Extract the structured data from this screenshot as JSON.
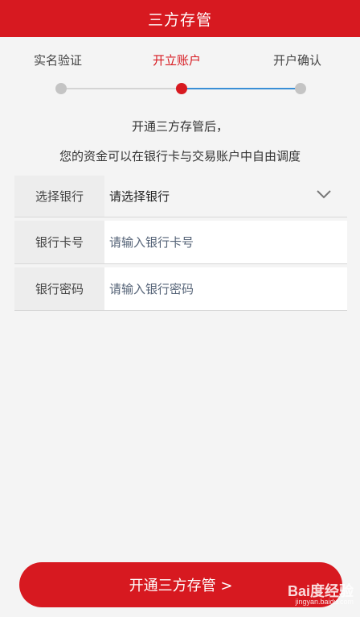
{
  "header": {
    "title": "三方存管"
  },
  "steps": [
    {
      "label": "实名验证",
      "state": "done"
    },
    {
      "label": "开立账户",
      "state": "active"
    },
    {
      "label": "开户确认",
      "state": "pending"
    }
  ],
  "info": {
    "line1": "开通三方存管后，",
    "line2": "您的资金可以在银行卡与交易账户中自由调度"
  },
  "form": {
    "bank_select": {
      "label": "选择银行",
      "value": "请选择银行",
      "icon": "chevron-down-icon"
    },
    "card_number": {
      "label": "银行卡号",
      "placeholder": "请输入银行卡号"
    },
    "bank_password": {
      "label": "银行密码",
      "placeholder": "请输入银行密码"
    }
  },
  "submit": {
    "label": "开通三方存管 >"
  },
  "watermark": {
    "logo": "Bai度经验",
    "url": "jingyan.baidu.com"
  },
  "colors": {
    "brand": "#d71920",
    "progress": "#3a8fd6",
    "background": "#f4f4f4"
  }
}
